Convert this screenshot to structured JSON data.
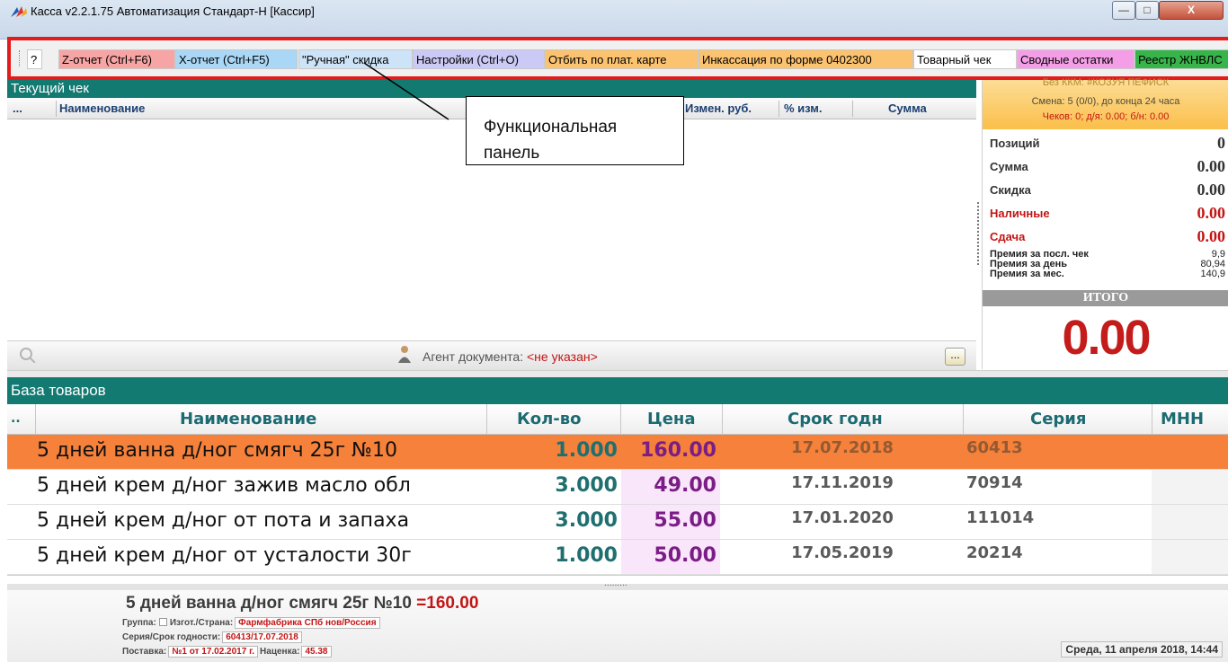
{
  "window": {
    "title": "Касса v2.2.1.75 Автоматизация Стандарт-Н [Кассир]",
    "minimize_label": "—",
    "maximize_label": "□",
    "close_label": "X"
  },
  "toolbar": {
    "items": [
      {
        "label": "?",
        "color": "#ffffff"
      },
      {
        "label": "Z-отчет (Ctrl+F6)",
        "color": "#f7a4a4"
      },
      {
        "label": "X-отчет (Ctrl+F5)",
        "color": "#a9d7f5"
      },
      {
        "label": "\"Ручная\" скидка",
        "color": "#cde3f7"
      },
      {
        "label": "Настройки (Ctrl+O)",
        "color": "#cbc9f5"
      },
      {
        "label": "Отбить по плат. карте",
        "color": "#fbc26f"
      },
      {
        "label": "Инкассация по форме 0402300",
        "color": "#fbc26f"
      },
      {
        "label": "Товарный чек",
        "color": "#ffffff"
      },
      {
        "label": "Сводные остатки",
        "color": "#f49ee8"
      },
      {
        "label": "Реестр ЖНВЛС",
        "color": "#37b44a"
      }
    ]
  },
  "current_check": {
    "title": "Текущий чек",
    "columns": [
      "...",
      "Наименование",
      "Измен. руб.",
      "% изм.",
      "Сумма"
    ],
    "agent_label": "Агент документа:",
    "agent_value": "<не указан>",
    "agent_button": "..."
  },
  "callout": {
    "text": "Функциональная панель"
  },
  "register": {
    "kkm": "Без ККМ: #КОЗУЯ ПЕФИСК",
    "shift": "Смена: 5 (0/0), до конца 24 часа",
    "checks": "Чеков: 0; д/я: 0.00; б/н: 0.00",
    "rows": [
      {
        "label": "Позиций",
        "value": "0",
        "red": false
      },
      {
        "label": "Сумма",
        "value": "0.00",
        "red": false
      },
      {
        "label": "Скидка",
        "value": "0.00",
        "red": false
      },
      {
        "label": "Наличные",
        "value": "0.00",
        "red": true
      },
      {
        "label": "Сдача",
        "value": "0.00",
        "red": true
      }
    ],
    "bonuses": [
      {
        "label": "Премия за посл. чек",
        "value": "9,9"
      },
      {
        "label": "Премия за день",
        "value": "80,94"
      },
      {
        "label": "Премия за мес.",
        "value": "140,9"
      }
    ],
    "total_label": "ИТОГО",
    "total_value": "0.00"
  },
  "product_base": {
    "title": "База товаров",
    "columns": [
      "..",
      "Наименование",
      "Кол-во",
      "Цена",
      "Срок годн",
      "Серия",
      "МНН"
    ],
    "rows": [
      {
        "name": "5 дней ванна д/ног смягч 25г №10",
        "qty": "1.000",
        "price": "160.00",
        "expiry": "17.07.2018",
        "series": "60413",
        "mnn": "",
        "selected": true
      },
      {
        "name": "5 дней крем д/ног зажив масло обл",
        "qty": "3.000",
        "price": "49.00",
        "expiry": "17.11.2019",
        "series": "70914",
        "mnn": "",
        "selected": false
      },
      {
        "name": "5 дней крем д/ног от пота и запаха",
        "qty": "3.000",
        "price": "55.00",
        "expiry": "17.01.2020",
        "series": "111014",
        "mnn": "",
        "selected": false
      },
      {
        "name": "5 дней крем д/ног от усталости 30г",
        "qty": "1.000",
        "price": "50.00",
        "expiry": "17.05.2019",
        "series": "20214",
        "mnn": "",
        "selected": false
      }
    ]
  },
  "detail": {
    "name": "5 дней ванна д/ног смягч 25г №10",
    "price": "=160.00",
    "group_label": "Группа:",
    "maker_label": "Изгот./Страна:",
    "maker_value": "Фармфабрика СПб нов/Россия",
    "series_label": "Серия/Срок годности:",
    "series_value": "60413/17.07.2018",
    "supply_label": "Поставка:",
    "supply_value": "№1 от 17.02.2017 г.",
    "markup_label": "Наценка:",
    "markup_value": "45.38"
  },
  "status": {
    "datetime": "Среда, 11 апреля 2018, 14:44"
  }
}
